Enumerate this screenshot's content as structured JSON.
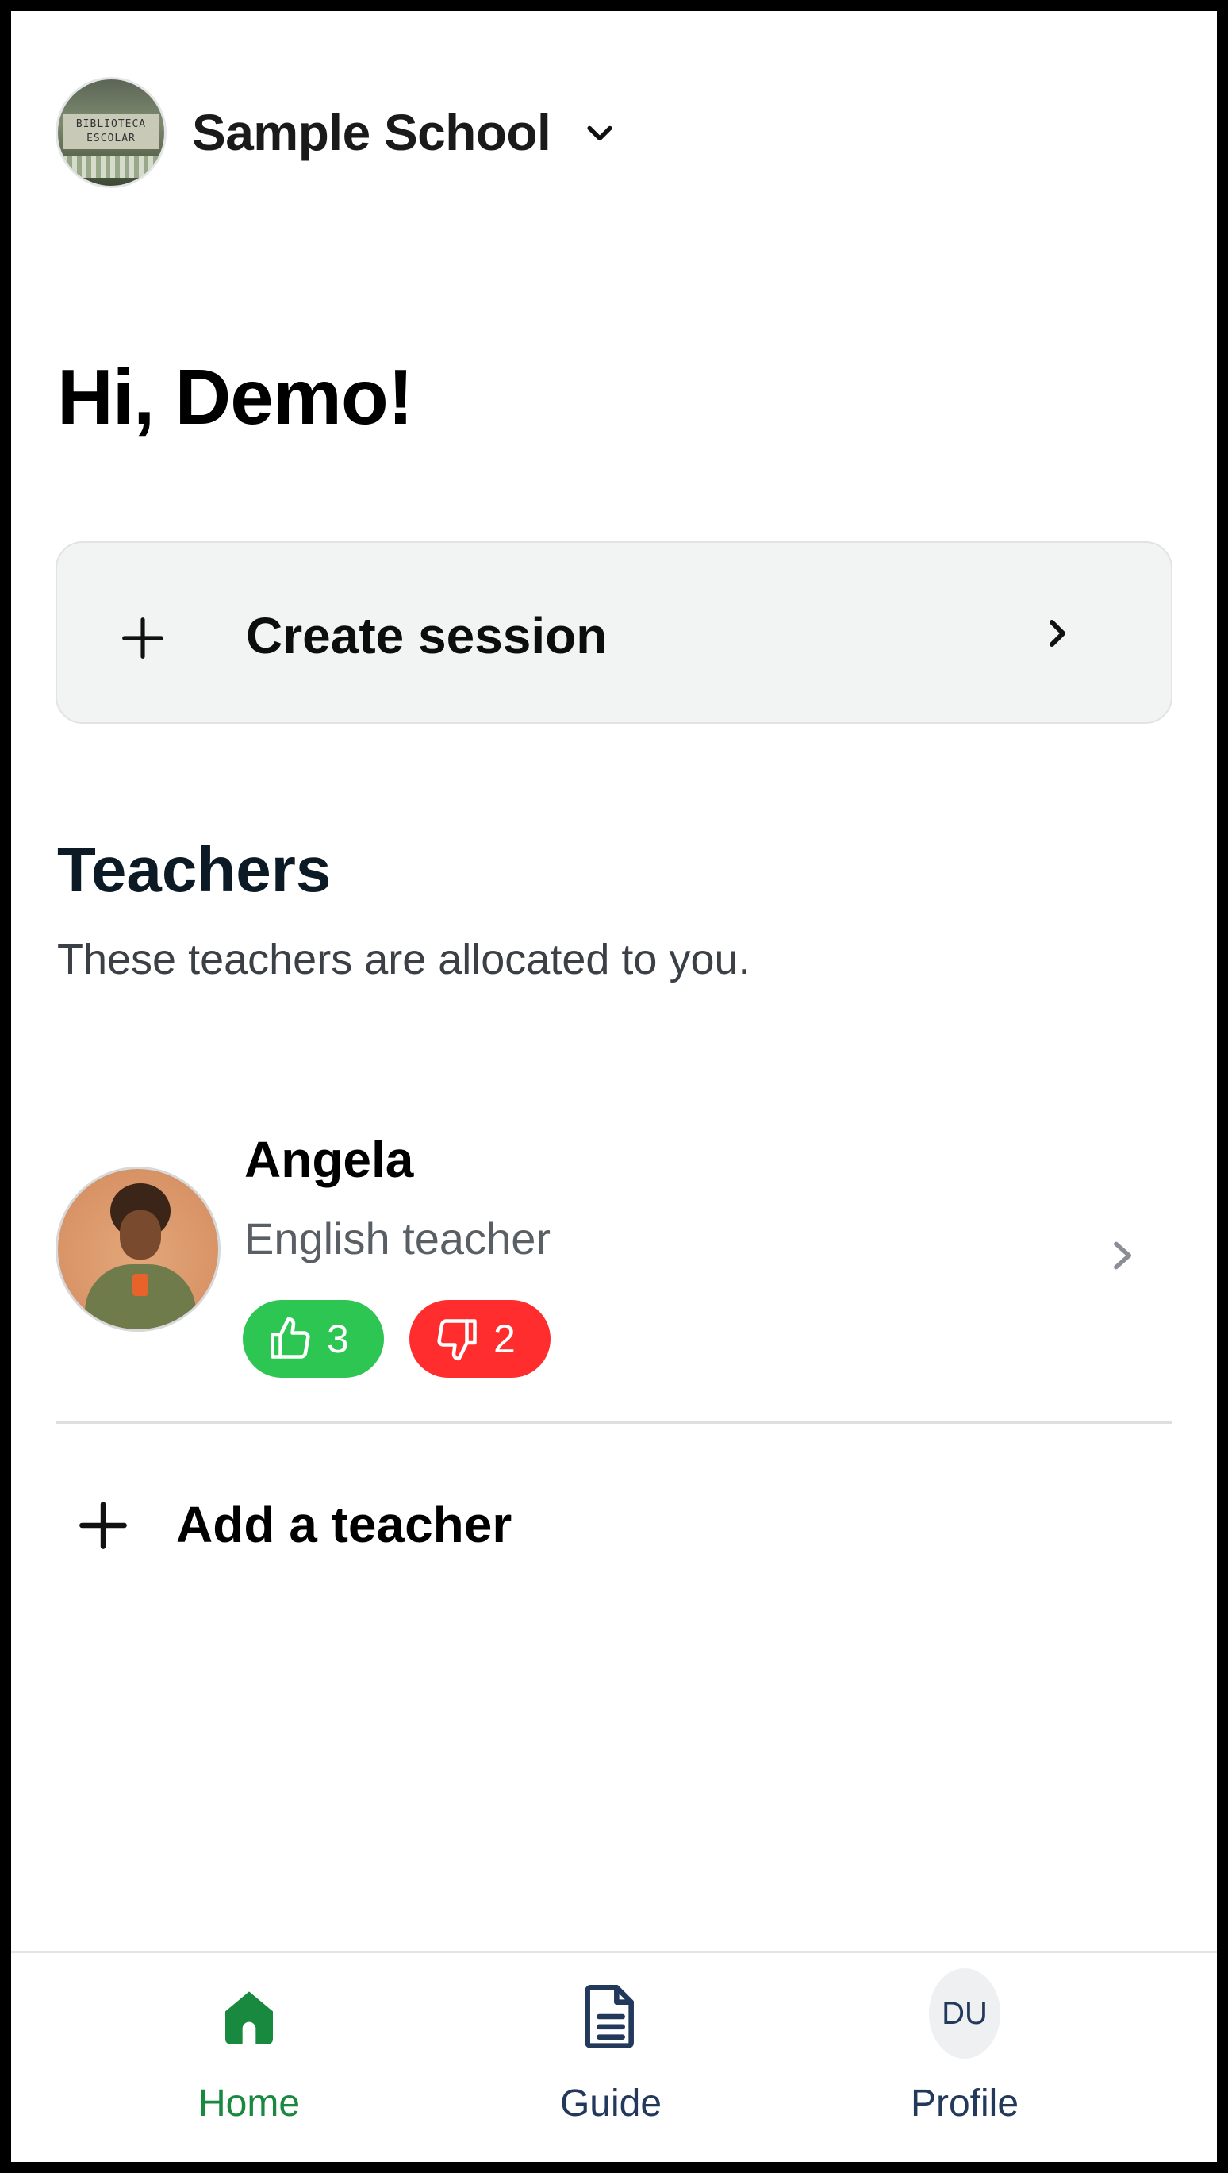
{
  "header": {
    "school_name": "Sample School",
    "school_logo_text": [
      "BIBLIOTECA",
      "ESCOLAR"
    ]
  },
  "greeting": "Hi, Demo!",
  "create_session": {
    "label": "Create session"
  },
  "teachers_section": {
    "title": "Teachers",
    "subtitle": "These teachers are allocated to you.",
    "teachers": [
      {
        "name": "Angela",
        "role": "English teacher",
        "likes": "3",
        "dislikes": "2"
      }
    ],
    "add_label": "Add a teacher"
  },
  "bottom_nav": {
    "items": [
      {
        "label": "Home",
        "icon": "home-icon",
        "active": true
      },
      {
        "label": "Guide",
        "icon": "document-icon",
        "active": false
      },
      {
        "label": "Profile",
        "icon": "avatar-initials",
        "active": false
      }
    ],
    "profile_initials": "DU"
  },
  "colors": {
    "accent_green": "#19893f",
    "like_green": "#2dc653",
    "dislike_red": "#ff2d2d",
    "nav_text": "#23395b",
    "card_bg": "#f2f3f3"
  }
}
